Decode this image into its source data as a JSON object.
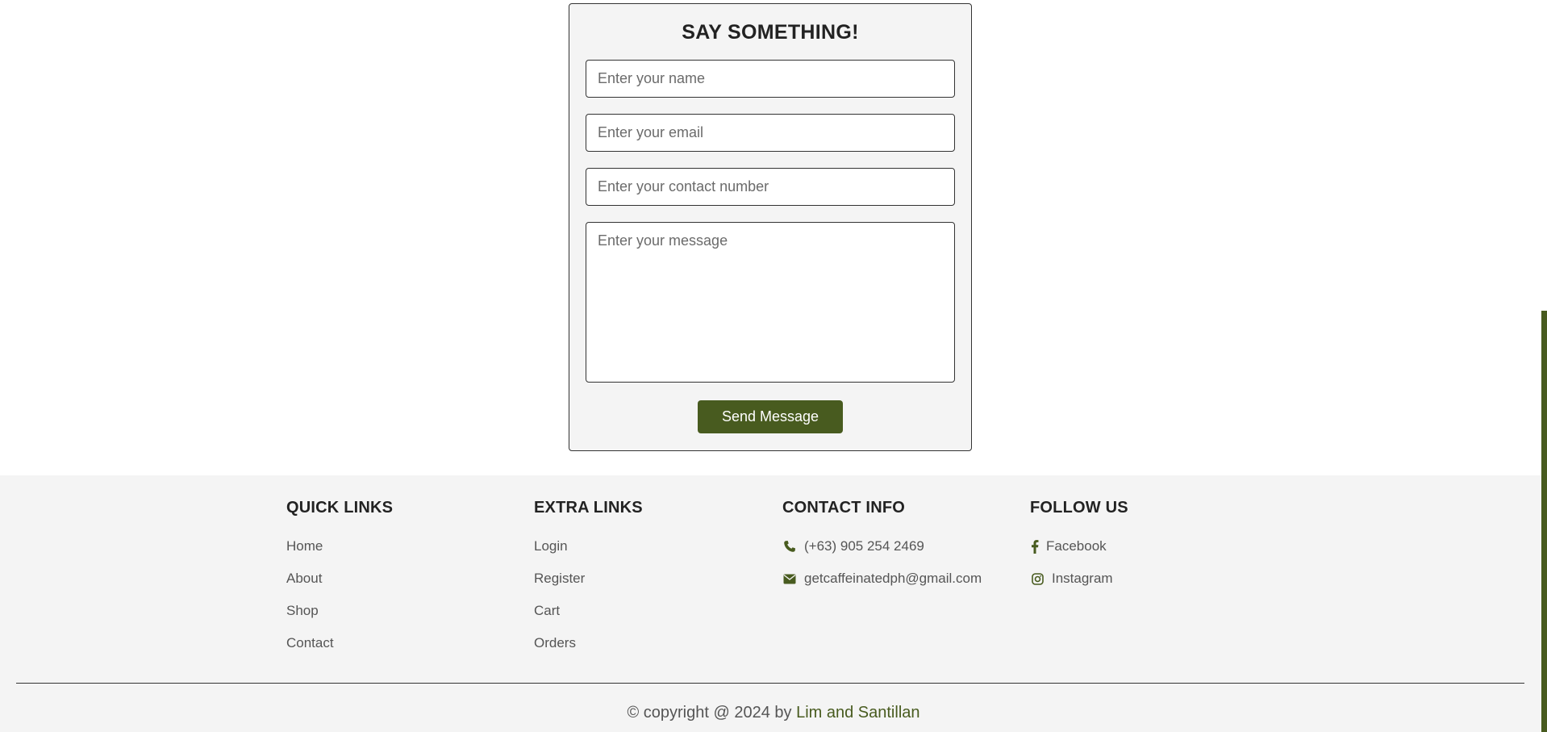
{
  "contact_form": {
    "title": "SAY SOMETHING!",
    "name_placeholder": "Enter your name",
    "email_placeholder": "Enter your email",
    "contact_placeholder": "Enter your contact number",
    "message_placeholder": "Enter your message",
    "submit_label": "Send Message"
  },
  "footer": {
    "quick_links": {
      "heading": "QUICK LINKS",
      "items": [
        "Home",
        "About",
        "Shop",
        "Contact"
      ]
    },
    "extra_links": {
      "heading": "EXTRA LINKS",
      "items": [
        "Login",
        "Register",
        "Cart",
        "Orders"
      ]
    },
    "contact_info": {
      "heading": "CONTACT INFO",
      "phone": "(+63) 905 254 2469",
      "email": "getcaffeinatedph@gmail.com",
      "icons": [
        "phone-icon",
        "envelope-icon"
      ]
    },
    "follow_us": {
      "heading": "FOLLOW US",
      "facebook": "Facebook",
      "instagram": "Instagram",
      "icons": [
        "facebook-icon",
        "instagram-icon"
      ]
    },
    "copyright_prefix": "© copyright @ 2024 by",
    "copyright_author": "Lim and Santillan"
  },
  "colors": {
    "accent": "#485b1f",
    "footer_bg": "#f4f4f4",
    "text": "#555555"
  }
}
